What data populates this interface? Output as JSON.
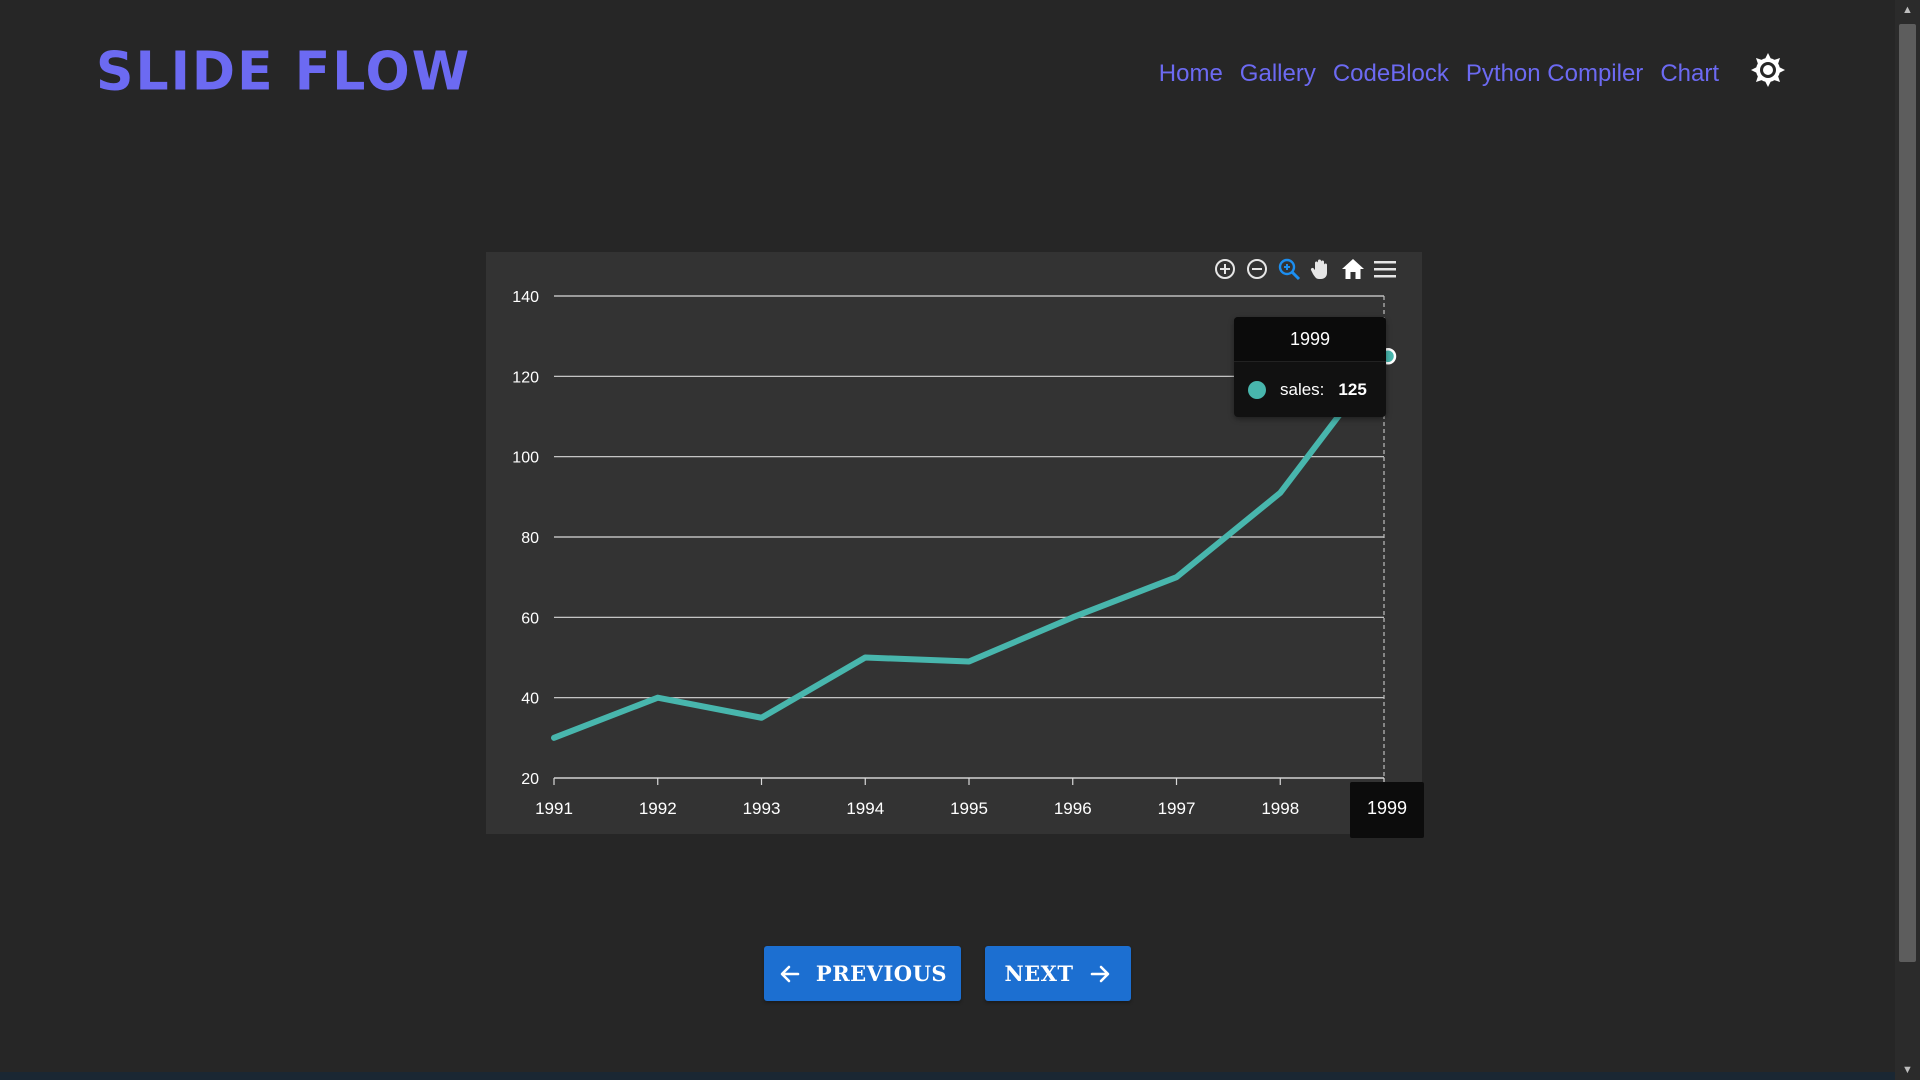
{
  "app": {
    "logo_text": "SLIDE FLOW",
    "accent_color": "#6c6af2"
  },
  "nav": {
    "items": [
      "Home",
      "Gallery",
      "CodeBlock",
      "Python Compiler",
      "Chart"
    ],
    "theme_icon": "sun-icon"
  },
  "toolbar": {
    "icons": [
      "zoom-in-icon",
      "zoom-out-icon",
      "selection-zoom-icon",
      "pan-icon",
      "reset-home-icon",
      "menu-icon"
    ]
  },
  "tooltip": {
    "title": "1999",
    "series_label": "sales:",
    "value": "125"
  },
  "x_tooltip": "1999",
  "buttons": {
    "previous": "PREVIOUS",
    "next": "NEXT"
  },
  "colors": {
    "line": "#48b6ad",
    "button": "#1c6fd1",
    "panel": "#333333",
    "background": "#262626"
  },
  "chart_data": {
    "type": "line",
    "x": [
      "1991",
      "1992",
      "1993",
      "1994",
      "1995",
      "1996",
      "1997",
      "1998",
      "1999"
    ],
    "series": [
      {
        "name": "sales",
        "values": [
          30,
          40,
          35,
          50,
          49,
          60,
          70,
          91,
          125
        ]
      }
    ],
    "ylim": [
      20,
      140
    ],
    "yticks": [
      20,
      40,
      60,
      80,
      100,
      120,
      140
    ],
    "grid": true,
    "highlighted_index": 8
  }
}
